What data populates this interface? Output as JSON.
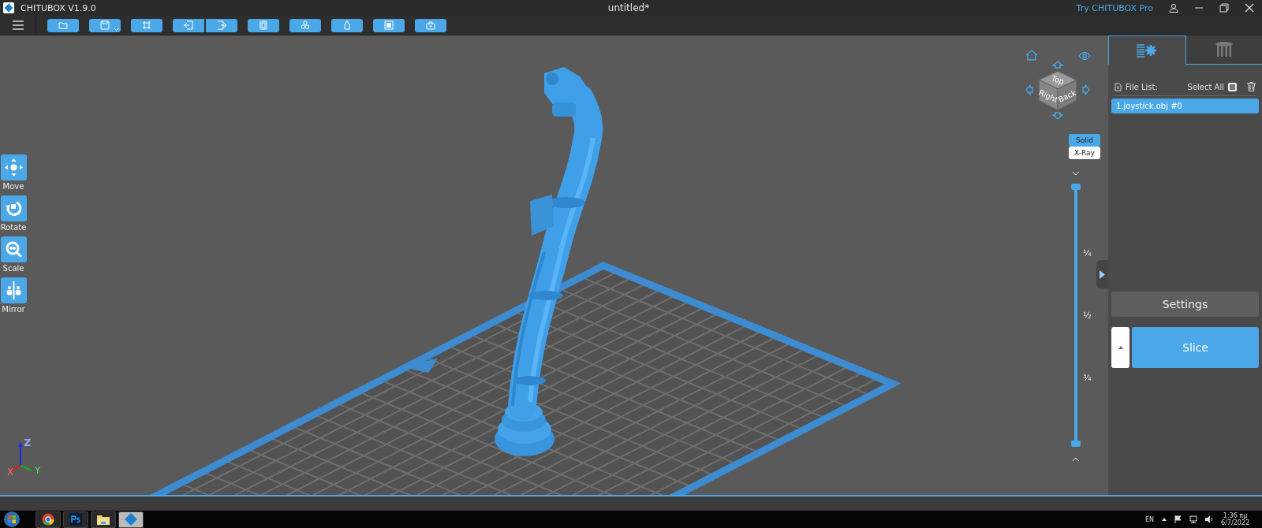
{
  "window": {
    "app_name": "CHITUBOX V1.9.0",
    "title": "untitled*",
    "promo_link": "Try CHITUBOX Pro"
  },
  "tools": [
    {
      "kind": "move",
      "label": "Move"
    },
    {
      "kind": "rotate",
      "label": "Rotate"
    },
    {
      "kind": "scale",
      "label": "Scale"
    },
    {
      "kind": "mirror",
      "label": "Mirror"
    }
  ],
  "view_cube": {
    "faces": [
      "Top",
      "Right",
      "Back"
    ]
  },
  "render_modes": [
    {
      "label": "Solid",
      "selected": true
    },
    {
      "label": "X-Ray",
      "selected": false
    }
  ],
  "layer_slider": {
    "level": 1,
    "ticks": [
      "¼",
      "½",
      "¾"
    ]
  },
  "panel": {
    "tabs": [
      {
        "kind": "settings",
        "selected": true
      },
      {
        "kind": "supports",
        "selected": false
      }
    ],
    "file_list_label": "File List:",
    "select_all_label": "Select All",
    "select_all_checked": false,
    "files": [
      {
        "name": "1.joystick.obj #0",
        "selected": true
      }
    ],
    "settings_button": "Settings",
    "slice_button": "Slice"
  },
  "axes": [
    "Z",
    "X",
    "Y"
  ],
  "taskbar": {
    "language": "EN",
    "time": "1:36 πμ",
    "date": "6/7/2022"
  }
}
